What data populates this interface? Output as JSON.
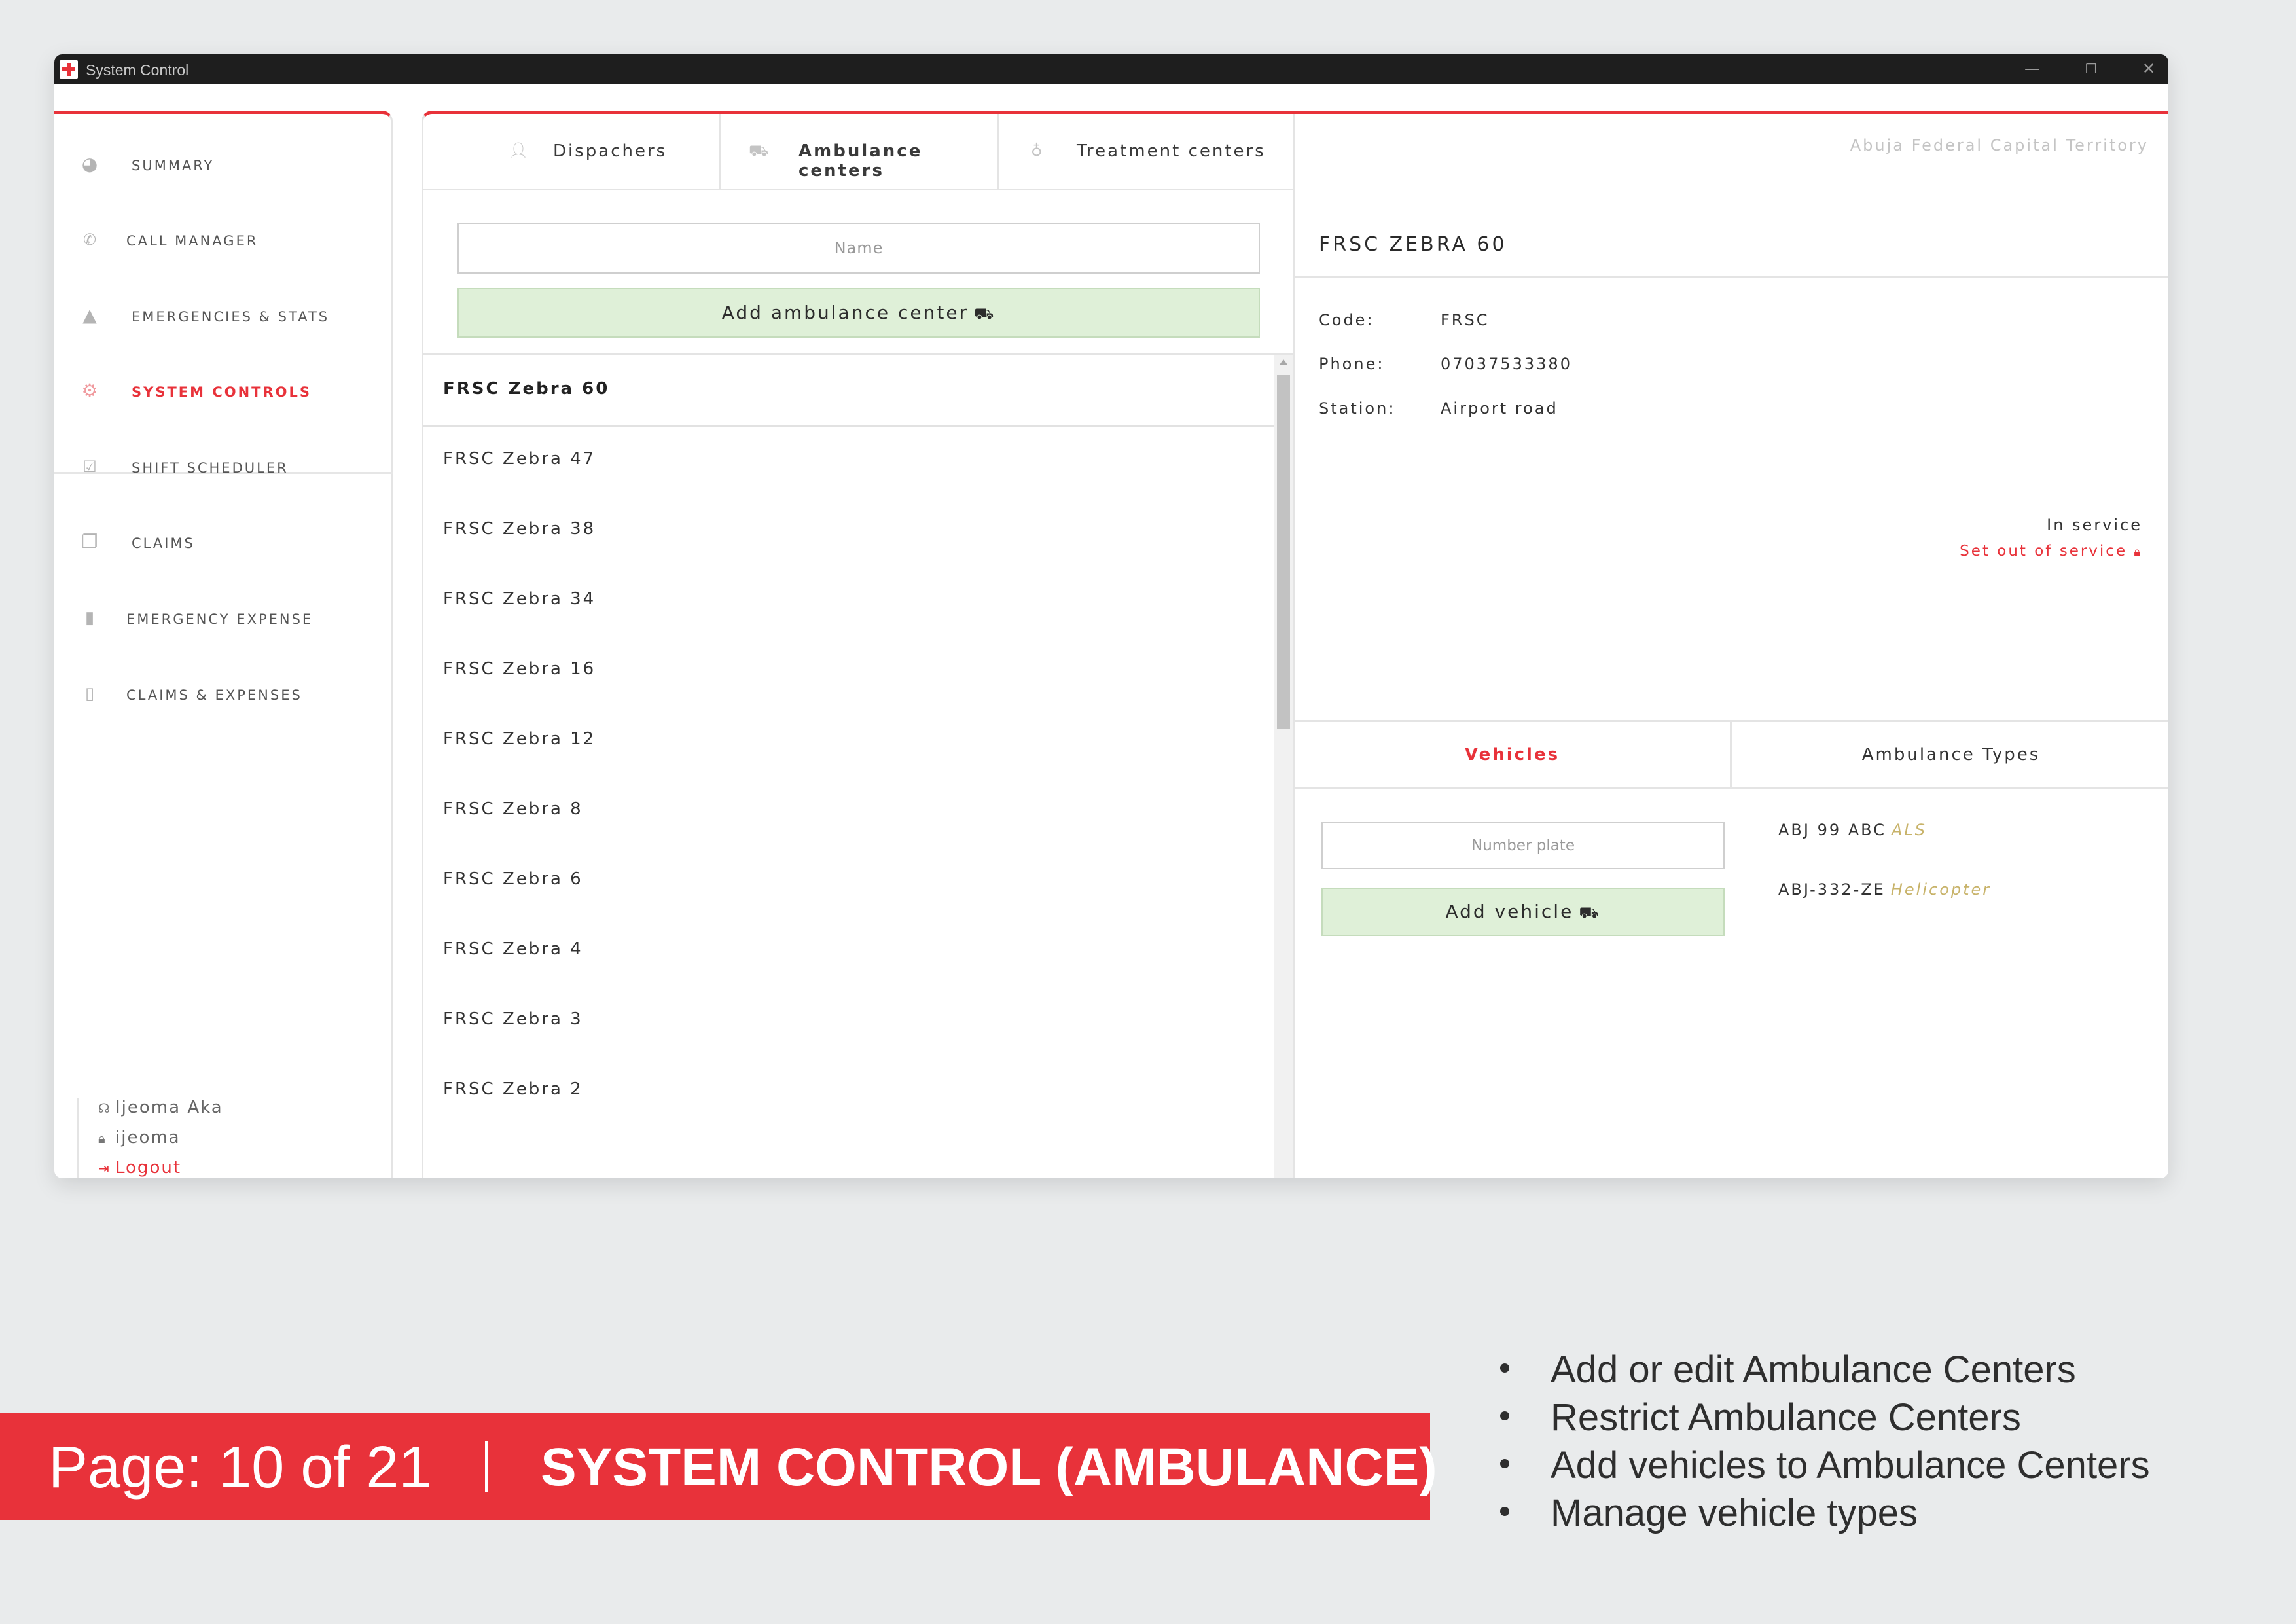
{
  "window": {
    "title": "System Control"
  },
  "window_controls": {
    "minimize": "—",
    "maximize": "❐",
    "close": "✕"
  },
  "sidebar": {
    "items": [
      {
        "label": "SUMMARY",
        "icon": "pie-chart-icon",
        "active": false
      },
      {
        "label": "CALL MANAGER",
        "icon": "phone-icon",
        "active": false
      },
      {
        "label": "EMERGENCIES & STATS",
        "icon": "warning-icon",
        "active": false
      },
      {
        "label": "SYSTEM CONTROLS",
        "icon": "cogs-icon",
        "active": true
      },
      {
        "label": "SHIFT SCHEDULER",
        "icon": "calendar-check-icon",
        "active": false
      },
      {
        "label": "CLAIMS",
        "icon": "files-icon",
        "active": false
      },
      {
        "label": "EMERGENCY EXPENSE",
        "icon": "bookmark-icon",
        "active": false
      },
      {
        "label": "CLAIMS & EXPENSES",
        "icon": "bookmark-outline-icon",
        "active": false
      }
    ],
    "user": {
      "name": "Ijeoma Aka",
      "username": "ijeoma",
      "logout": "Logout"
    }
  },
  "tabs": [
    {
      "label": "Dispachers",
      "icon": "user-icon",
      "active": false
    },
    {
      "label": "Ambulance centers",
      "icon": "ambulance-icon",
      "active": true
    },
    {
      "label": "Treatment centers",
      "icon": "stethoscope-icon",
      "active": false
    }
  ],
  "center_form": {
    "name_placeholder": "Name",
    "add_button": "Add ambulance center"
  },
  "centers": [
    "FRSC Zebra 60",
    "FRSC Zebra 47",
    "FRSC Zebra 38",
    "FRSC Zebra 34",
    "FRSC Zebra 16",
    "FRSC Zebra 12",
    "FRSC Zebra 8",
    "FRSC Zebra 6",
    "FRSC Zebra 4",
    "FRSC Zebra 3",
    "FRSC Zebra 2"
  ],
  "selected_center": 0,
  "detail": {
    "region": "Abuja Federal Capital Territory",
    "title": "FRSC ZEBRA 60",
    "code_label": "Code:",
    "code": "FRSC",
    "phone_label": "Phone:",
    "phone": "07037533380",
    "station_label": "Station:",
    "station": "Airport road",
    "status": "In service",
    "status_action": "Set out of service"
  },
  "sub_tabs": [
    {
      "label": "Vehicles",
      "active": true
    },
    {
      "label": "Ambulance Types",
      "active": false
    }
  ],
  "vehicle_form": {
    "plate_placeholder": "Number plate",
    "add_button": "Add vehicle"
  },
  "vehicles": [
    {
      "plate": "ABJ 99 ABC",
      "type": "ALS"
    },
    {
      "plate": "ABJ-332-ZE",
      "type": "Helicopter"
    }
  ],
  "caption": {
    "page": "Page: 10 of 21",
    "title": "SYSTEM CONTROL (AMBULANCE)",
    "bullets": [
      "Add or edit Ambulance Centers",
      "Restrict Ambulance Centers",
      "Add vehicles to Ambulance Centers",
      "Manage vehicle types"
    ]
  },
  "colors": {
    "accent": "#e8323a",
    "success_bg": "#dff0d8",
    "type_tag": "#c8b36a"
  }
}
